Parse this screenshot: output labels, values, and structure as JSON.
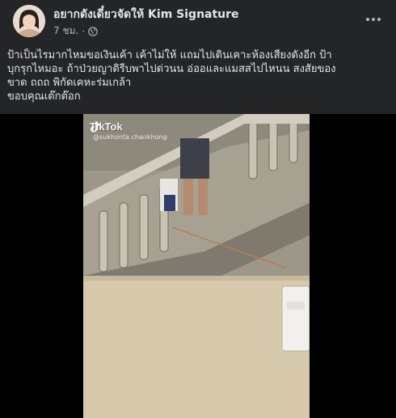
{
  "post": {
    "author": "อยากดังเดี๋ยวจัดให้ Kim Signature",
    "timestamp": "7 ชม.",
    "separator": "·",
    "privacy_icon": "globe-icon",
    "more_icon": "more-horizontal-icon",
    "caption_lines": [
      "ป้าเป็นไรมากไหมขอเงินเค้า เค้าไม่ให้ แถมไปเดินเคาะห้องเสียงดังอีก ป้า",
      "บุกรุกไหมอะ ถ้าป่วยญาติรีบพาไปด่วนน อ่ออและแมสสไปไหนน สงสัยของ",
      "ขาด ถถถ พิกัดเคหะร่มเกล้า",
      "ขอบคุณเต๊กต๊อก"
    ]
  },
  "video": {
    "watermark_logo": "TikTok",
    "watermark_handle": "@sukhonta.chankhong"
  },
  "colors": {
    "background": "#242526",
    "primary_text": "#e4e6eb",
    "secondary_text": "#b0b3b8"
  }
}
